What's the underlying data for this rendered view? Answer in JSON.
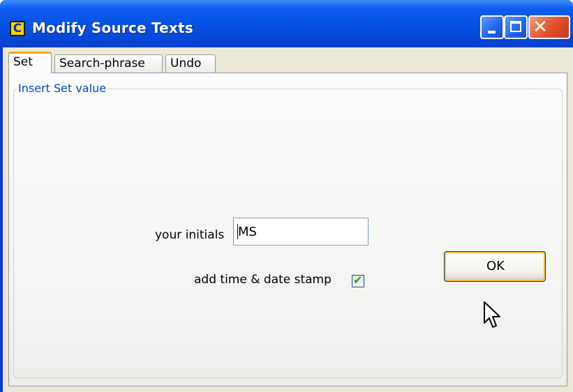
{
  "window": {
    "title": "Modify Source Texts",
    "app_icon_letter": "C",
    "controls": [
      "minimize",
      "maximize",
      "close"
    ]
  },
  "tabs": [
    {
      "label": "Set",
      "active": true
    },
    {
      "label": "Search-phrase",
      "active": false
    },
    {
      "label": "Undo",
      "active": false
    }
  ],
  "set_panel": {
    "group_title": "Insert Set value",
    "initials_label": "your initials",
    "initials_value": "MS",
    "timestamp_label": "add time & date stamp",
    "timestamp_checked": true,
    "ok_label": "OK"
  },
  "colors": {
    "title_bar": "#0554e6",
    "group_title": "#0046d5",
    "active_tab_accent": "#f5a623",
    "checkmark": "#21a121"
  },
  "icons": [
    "app-icon",
    "minimize-icon",
    "maximize-icon",
    "close-icon",
    "checkmark-icon",
    "mouse-cursor-icon"
  ]
}
